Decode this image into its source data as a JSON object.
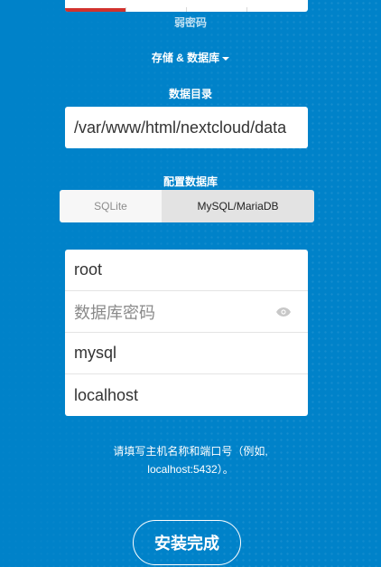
{
  "password_strength": {
    "label": "弱密码",
    "level_fraction": 0.25,
    "color": "#d2322d"
  },
  "advanced": {
    "label": "存储 & 数据库",
    "caret_icon": "caret-down-icon"
  },
  "data_dir": {
    "label": "数据目录",
    "value": "/var/www/html/nextcloud/data"
  },
  "db_config": {
    "label": "配置数据库",
    "tabs": [
      {
        "label": "SQLite",
        "selected": false
      },
      {
        "label": "MySQL/MariaDB",
        "selected": true
      }
    ],
    "fields": {
      "user": {
        "value": "root"
      },
      "password": {
        "placeholder": "数据库密码",
        "toggle_icon": "eye-icon"
      },
      "name": {
        "value": "mysql"
      },
      "host": {
        "value": "localhost"
      }
    },
    "hint_line1": "请填写主机名称和端口号（例如,",
    "hint_line2": "localhost:5432）。"
  },
  "finish_button": {
    "label": "安装完成"
  },
  "colors": {
    "background": "#0082c9",
    "accent": "#ffffff"
  }
}
